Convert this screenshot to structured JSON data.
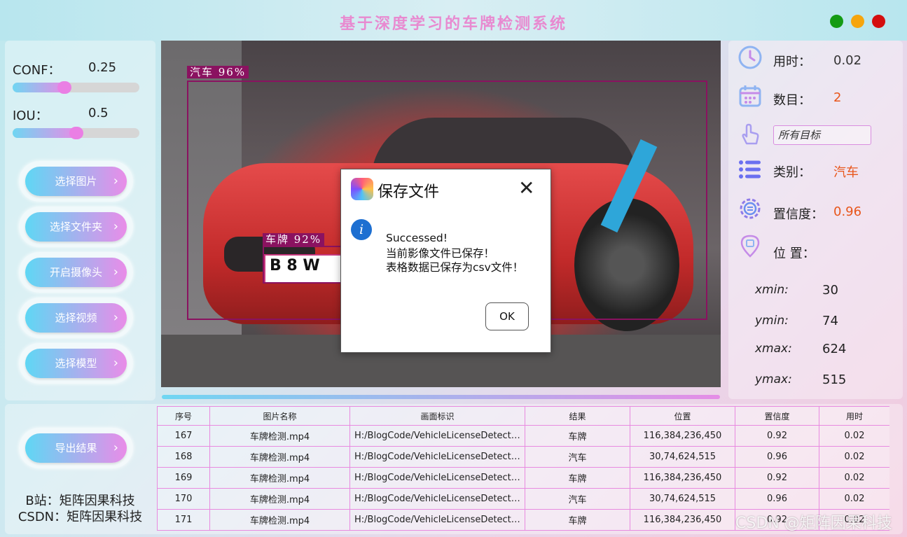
{
  "app": {
    "title": "基于深度学习的车牌检测系统"
  },
  "params": {
    "conf_label": "CONF：",
    "conf_value": "0.25",
    "conf_level": 0.25,
    "iou_label": "IOU：",
    "iou_value": "0.5",
    "iou_level": 0.5
  },
  "buttons": {
    "select_image": "选择图片",
    "select_folder": "选择文件夹",
    "open_camera": "开启摄像头",
    "select_video": "选择视频",
    "select_model": "选择模型",
    "export_results": "导出结果",
    "chevron": "›"
  },
  "detections": [
    {
      "label": "汽车 96%"
    },
    {
      "label": "车牌 92%"
    }
  ],
  "plate_text": "B 8 W",
  "dialog": {
    "title": "保存文件",
    "close": "✕",
    "info_icon": "i",
    "line1": "Successed!",
    "line2": "当前影像文件已保存！",
    "line3": "表格数据已保存为csv文件！",
    "ok": "OK"
  },
  "info": {
    "time_label": "用时：",
    "time_value": "0.02",
    "count_label": "数目：",
    "count_value": "2",
    "target_select": "所有目标",
    "class_label": "类别：",
    "class_value": "汽车",
    "conf_label": "置信度：",
    "conf_value": "0.96",
    "position_label": "位 置：",
    "xmin_label": "xmin:",
    "xmin_value": "30",
    "ymin_label": "ymin:",
    "ymin_value": "74",
    "xmax_label": "xmax:",
    "xmax_value": "624",
    "ymax_label": "ymax:",
    "ymax_value": "515"
  },
  "footer": {
    "bilibili": "B站：矩阵因果科技",
    "csdn": "CSDN：矩阵因果科技"
  },
  "table": {
    "headers": [
      "序号",
      "图片名称",
      "画面标识",
      "结果",
      "位置",
      "置信度",
      "用时"
    ],
    "rows": [
      [
        "167",
        "车牌检测.mp4",
        "H:/BlogCode/VehicleLicenseDetection...",
        "车牌",
        "116,384,236,450",
        "0.92",
        "0.02"
      ],
      [
        "168",
        "车牌检测.mp4",
        "H:/BlogCode/VehicleLicenseDetection...",
        "汽车",
        "30,74,624,515",
        "0.96",
        "0.02"
      ],
      [
        "169",
        "车牌检测.mp4",
        "H:/BlogCode/VehicleLicenseDetection...",
        "车牌",
        "116,384,236,450",
        "0.92",
        "0.02"
      ],
      [
        "170",
        "车牌检测.mp4",
        "H:/BlogCode/VehicleLicenseDetection...",
        "汽车",
        "30,74,624,515",
        "0.96",
        "0.02"
      ],
      [
        "171",
        "车牌检测.mp4",
        "H:/BlogCode/VehicleLicenseDetection...",
        "车牌",
        "116,384,236,450",
        "0.92",
        "0.02"
      ]
    ]
  },
  "watermark": "CSDN @矩阵因果科技",
  "colors": {
    "accent_pink": "#e88ad0",
    "accent_cyan": "#5fd7f4",
    "value_orange": "#e8561b",
    "detect_box": "#8a1260"
  }
}
